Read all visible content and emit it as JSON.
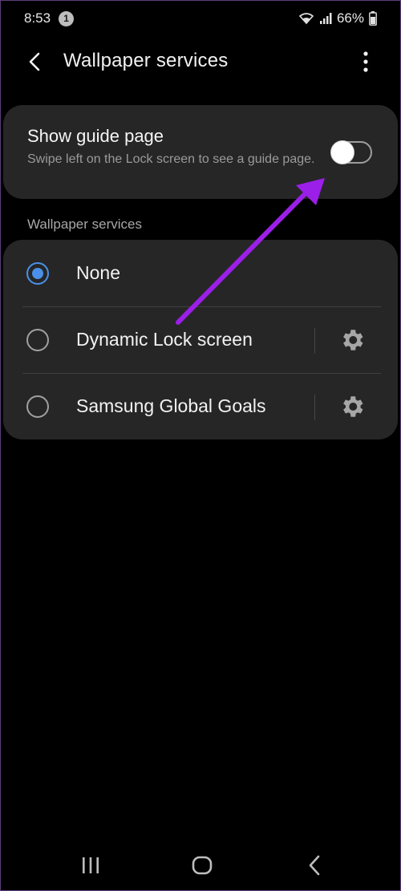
{
  "status_bar": {
    "time": "8:53",
    "notification_count": "1",
    "battery_percent": "66%",
    "icons": [
      "wifi-icon",
      "signal-icon",
      "battery-icon"
    ]
  },
  "app_bar": {
    "title": "Wallpaper services",
    "back_icon": "chevron-left-icon",
    "more_icon": "more-vertical-icon"
  },
  "guide_card": {
    "title": "Show guide page",
    "subtitle": "Swipe left on the Lock screen to see a guide page.",
    "toggle_on": false
  },
  "section_label": "Wallpaper services",
  "options": [
    {
      "label": "None",
      "selected": true,
      "has_settings": false
    },
    {
      "label": "Dynamic Lock screen",
      "selected": false,
      "has_settings": true
    },
    {
      "label": "Samsung Global Goals",
      "selected": false,
      "has_settings": true
    }
  ],
  "nav_bar": {
    "icons": [
      "recents-icon",
      "home-icon",
      "back-icon"
    ]
  },
  "colors": {
    "background": "#000000",
    "card": "#262626",
    "accent": "#4a90e8",
    "annotation_arrow": "#9b1fe8"
  }
}
